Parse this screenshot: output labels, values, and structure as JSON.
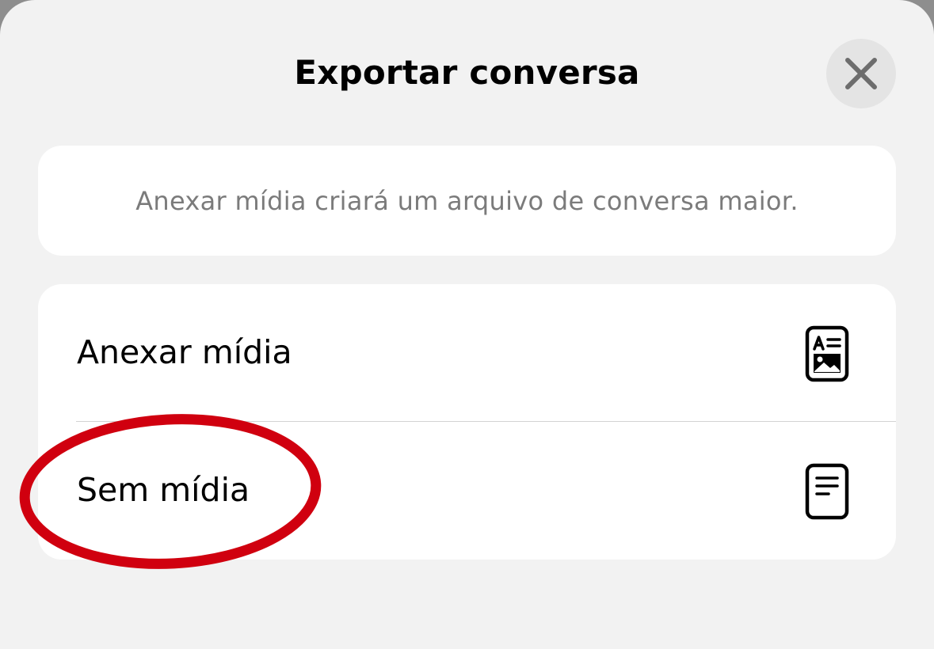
{
  "sheet": {
    "title": "Exportar conversa",
    "close_icon": "close-icon"
  },
  "info": {
    "text": "Anexar mídia criará um arquivo de conversa maior."
  },
  "options": [
    {
      "label": "Anexar mídia",
      "icon": "document-with-media-icon"
    },
    {
      "label": "Sem mídia",
      "icon": "document-text-icon"
    }
  ],
  "annotation": {
    "shape": "ellipse",
    "color": "#d0000f",
    "target": "Sem mídia"
  },
  "colors": {
    "sheet_background": "#f2f2f2",
    "card_background": "#ffffff",
    "secondary_text": "#7b7b7b",
    "close_button_background": "#e4e4e4"
  }
}
